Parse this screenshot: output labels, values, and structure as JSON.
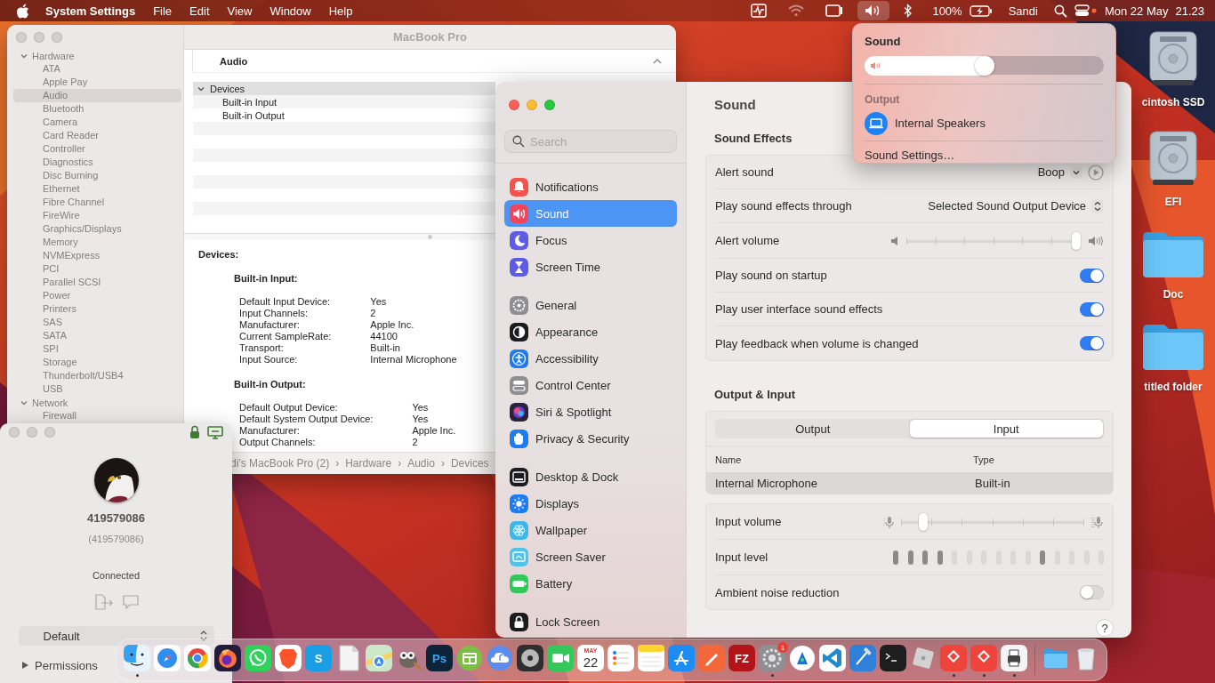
{
  "menu_bar": {
    "app_name": "System Settings",
    "menus": [
      "File",
      "Edit",
      "View",
      "Window",
      "Help"
    ],
    "extras": [
      {
        "kind": "activity",
        "active": false
      },
      {
        "kind": "wifi",
        "active": false
      },
      {
        "kind": "display",
        "active": false
      },
      {
        "kind": "volume",
        "active": true
      },
      {
        "kind": "bluetooth",
        "active": false
      }
    ],
    "battery": "100%",
    "user": "Sandi",
    "date": "Mon 22 May",
    "time": "21.23"
  },
  "desktop_icons": [
    {
      "kind": "disk",
      "label": "cintosh SSD"
    },
    {
      "kind": "disk",
      "label": "EFI"
    },
    {
      "kind": "folder",
      "label": "Doc"
    },
    {
      "kind": "folder",
      "label": "titled folder"
    }
  ],
  "system_information": {
    "title": "MacBook Pro",
    "sidebar": [
      {
        "label": "Hardware",
        "expanded": true,
        "children": [
          {
            "label": "ATA",
            "selected": false
          },
          {
            "label": "Apple Pay",
            "selected": false
          },
          {
            "label": "Audio",
            "selected": true
          },
          {
            "label": "Bluetooth",
            "selected": false
          },
          {
            "label": "Camera",
            "selected": false
          },
          {
            "label": "Card Reader",
            "selected": false
          },
          {
            "label": "Controller",
            "selected": false
          },
          {
            "label": "Diagnostics",
            "selected": false
          },
          {
            "label": "Disc Burning",
            "selected": false
          },
          {
            "label": "Ethernet",
            "selected": false
          },
          {
            "label": "Fibre Channel",
            "selected": false
          },
          {
            "label": "FireWire",
            "selected": false
          },
          {
            "label": "Graphics/Displays",
            "selected": false
          },
          {
            "label": "Memory",
            "selected": false
          },
          {
            "label": "NVMExpress",
            "selected": false
          },
          {
            "label": "PCI",
            "selected": false
          },
          {
            "label": "Parallel SCSI",
            "selected": false
          },
          {
            "label": "Power",
            "selected": false
          },
          {
            "label": "Printers",
            "selected": false
          },
          {
            "label": "SAS",
            "selected": false
          },
          {
            "label": "SATA",
            "selected": false
          },
          {
            "label": "SPI",
            "selected": false
          },
          {
            "label": "Storage",
            "selected": false
          },
          {
            "label": "Thunderbolt/USB4",
            "selected": false
          },
          {
            "label": "USB",
            "selected": false
          }
        ]
      },
      {
        "label": "Network",
        "expanded": true,
        "children": [
          {
            "label": "Firewall",
            "selected": false
          }
        ]
      }
    ],
    "header": "Audio",
    "tree": [
      {
        "label": "Devices",
        "expanded": true,
        "children": [
          {
            "label": "Built-in Input"
          },
          {
            "label": "Built-in Output"
          }
        ]
      }
    ],
    "details_title": "Devices:",
    "sections": [
      {
        "title": "Built-in Input:",
        "rows": [
          {
            "key": "Default Input Device:",
            "value": "Yes"
          },
          {
            "key": "Input Channels:",
            "value": "2"
          },
          {
            "key": "Manufacturer:",
            "value": "Apple Inc."
          },
          {
            "key": "Current SampleRate:",
            "value": "44100"
          },
          {
            "key": "Transport:",
            "value": "Built-in"
          },
          {
            "key": "Input Source:",
            "value": "Internal Microphone"
          }
        ]
      },
      {
        "title": "Built-in Output:",
        "rows": [
          {
            "key": "Default Output Device:",
            "value": "Yes"
          },
          {
            "key": "Default System Output Device:",
            "value": "Yes"
          },
          {
            "key": "Manufacturer:",
            "value": "Apple Inc."
          },
          {
            "key": "Output Channels:",
            "value": "2"
          }
        ]
      }
    ],
    "path": [
      "di’s MacBook Pro (2)",
      "›",
      "Hardware",
      "›",
      "Audio",
      "›",
      "Devices"
    ]
  },
  "system_settings": {
    "search": {
      "placeholder": "Search"
    },
    "sidebar": [
      {
        "items": [
          {
            "label": "Notifications",
            "kind": "bell",
            "color": "#f4524d",
            "selected": false
          },
          {
            "label": "Sound",
            "kind": "speaker",
            "color": "#f2445a",
            "selected": true
          },
          {
            "label": "Focus",
            "kind": "moon",
            "color": "#5e5ce6",
            "selected": false
          },
          {
            "label": "Screen Time",
            "kind": "hourglass",
            "color": "#5e5ce6",
            "selected": false
          }
        ]
      },
      {
        "items": [
          {
            "label": "General",
            "kind": "gear",
            "color": "#8e8e93",
            "selected": false
          },
          {
            "label": "Appearance",
            "kind": "contrast",
            "color": "#1c1c1e",
            "selected": false
          },
          {
            "label": "Accessibility",
            "kind": "person",
            "color": "#1e7cf2",
            "selected": false
          },
          {
            "label": "Control Center",
            "kind": "switches",
            "color": "#8e8e93",
            "selected": false
          },
          {
            "label": "Siri & Spotlight",
            "kind": "orb",
            "color": "#2a2340",
            "selected": false
          },
          {
            "label": "Privacy & Security",
            "kind": "hand",
            "color": "#1e7cf2",
            "selected": false
          }
        ]
      },
      {
        "items": [
          {
            "label": "Desktop & Dock",
            "kind": "dock",
            "color": "#1c1c1e",
            "selected": false
          },
          {
            "label": "Displays",
            "kind": "sun",
            "color": "#1e7cf2",
            "selected": false
          },
          {
            "label": "Wallpaper",
            "kind": "flower",
            "color": "#3fb8e8",
            "selected": false
          },
          {
            "label": "Screen Saver",
            "kind": "screen",
            "color": "#4fc3e8",
            "selected": false
          },
          {
            "label": "Battery",
            "kind": "battery",
            "color": "#34c759",
            "selected": false
          }
        ]
      },
      {
        "items": [
          {
            "label": "Lock Screen",
            "kind": "lock",
            "color": "#1c1c1e",
            "selected": false
          }
        ]
      }
    ],
    "title": "Sound",
    "sections": [
      {
        "title": "Sound Effects",
        "rows": [
          {
            "kind": "dropdown",
            "label": "Alert sound",
            "value": "Boop"
          },
          {
            "kind": "popup",
            "label": "Play sound effects through",
            "value": "Selected Sound Output Device"
          },
          {
            "kind": "volume-slider",
            "label": "Alert volume",
            "level": 1
          },
          {
            "kind": "toggle",
            "label": "Play sound on startup",
            "on": true
          },
          {
            "kind": "toggle",
            "label": "Play user interface sound effects",
            "on": true
          },
          {
            "kind": "toggle",
            "label": "Play feedback when volume is changed",
            "on": true
          }
        ]
      },
      {
        "title": "Output & Input",
        "device_tabs": [
          {
            "label": "Output",
            "selected": false
          },
          {
            "label": "Input",
            "selected": true
          }
        ],
        "columns": [
          "Name",
          "Type"
        ],
        "devices": [
          {
            "cells": [
              "Internal Microphone",
              "Built-in"
            ],
            "selected": true
          }
        ],
        "rows": [
          {
            "kind": "mic-slider",
            "label": "Input volume",
            "level": 0.1
          },
          {
            "kind": "meter",
            "label": "Input level",
            "segments": [
              {
                "on": true
              },
              {
                "on": true
              },
              {
                "on": true
              },
              {
                "on": true
              },
              {
                "on": false
              },
              {
                "on": false
              },
              {
                "on": false
              },
              {
                "on": false
              },
              {
                "on": false
              },
              {
                "on": false
              },
              {
                "on": true
              },
              {
                "on": false
              },
              {
                "on": false
              },
              {
                "on": false
              },
              {
                "on": false
              }
            ]
          },
          {
            "kind": "toggle",
            "label": "Ambient noise reduction",
            "on": false
          }
        ]
      }
    ],
    "help": "?"
  },
  "remote_panel": {
    "id": "419579086",
    "id_secondary": "(419579086)",
    "status": "Connected",
    "profile": "Default",
    "permissions": {
      "label": "Permissions",
      "expanded": false
    }
  },
  "sound_menu": {
    "title": "Sound",
    "level": 0.5,
    "section": "Output",
    "devices": [
      {
        "label": "Internal Speakers",
        "selected": true
      }
    ],
    "settings_link": "Sound Settings…"
  },
  "dock": {
    "apps": [
      {
        "kind": "finder",
        "running": true
      },
      {
        "kind": "safari",
        "running": false
      },
      {
        "kind": "chrome",
        "running": false
      },
      {
        "kind": "firefox",
        "running": false
      },
      {
        "kind": "whatsapp",
        "running": false
      },
      {
        "kind": "brave",
        "running": false
      },
      {
        "kind": "letter",
        "label": "S",
        "running": false
      },
      {
        "kind": "document",
        "running": false
      },
      {
        "kind": "maps",
        "running": false
      },
      {
        "kind": "gimp",
        "running": false
      },
      {
        "kind": "letter",
        "label": "Ps",
        "running": false
      },
      {
        "kind": "box",
        "running": false
      },
      {
        "kind": "cloud",
        "running": false
      },
      {
        "kind": "disc",
        "running": false
      },
      {
        "kind": "camera",
        "running": false
      },
      {
        "kind": "calendar",
        "month": "MAY",
        "day": "22",
        "running": false
      },
      {
        "kind": "list",
        "running": false
      },
      {
        "kind": "notes",
        "running": false
      },
      {
        "kind": "appstore",
        "running": false
      },
      {
        "kind": "pen",
        "running": false
      },
      {
        "kind": "letter",
        "label": "FZ",
        "running": false
      },
      {
        "kind": "settings",
        "badge": "1",
        "running": true
      },
      {
        "kind": "circle",
        "running": false
      },
      {
        "kind": "ribbon",
        "running": false
      },
      {
        "kind": "hammer",
        "running": false
      },
      {
        "kind": "terminal",
        "running": false
      },
      {
        "kind": "cube",
        "running": false
      },
      {
        "kind": "diamond",
        "running": true
      },
      {
        "kind": "diamond",
        "running": true
      },
      {
        "kind": "printer",
        "running": true
      }
    ],
    "stacks": [
      {
        "kind": "folder"
      },
      {
        "kind": "trash"
      }
    ]
  }
}
